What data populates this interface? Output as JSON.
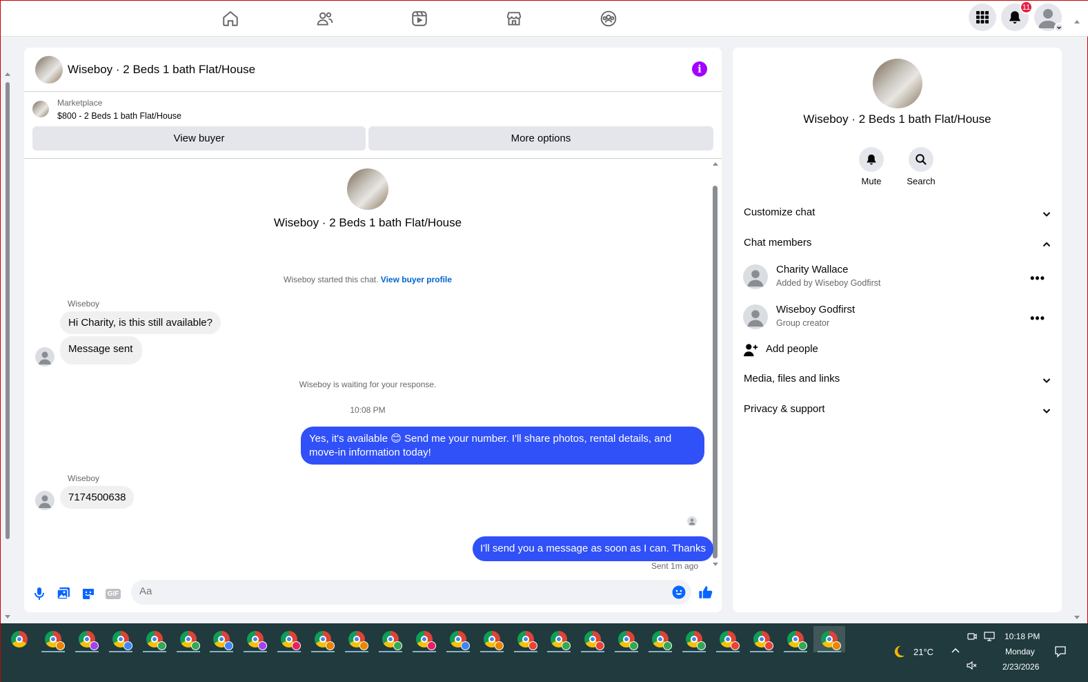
{
  "topnav": {
    "icons": [
      "home-icon",
      "friends-icon",
      "watch-icon",
      "marketplace-icon",
      "groups-icon"
    ],
    "notification_count": "11"
  },
  "chat": {
    "title": "Wiseboy · 2 Beds 1 bath Flat/House",
    "marketplace_label": "Marketplace",
    "listing": "$800 - 2 Beds 1 bath Flat/House",
    "view_buyer": "View buyer",
    "more_options": "More options",
    "intro_title": "Wiseboy · 2 Beds 1 bath Flat/House",
    "started_text": "Wiseboy started this chat.",
    "started_link": "View buyer profile",
    "messages": [
      {
        "sender": "Wiseboy",
        "text": "Hi Charity, is this still available?"
      },
      {
        "text": "Message sent"
      },
      {
        "system": "Wiseboy is waiting for your response."
      },
      {
        "time": "10:08 PM"
      },
      {
        "text": "Yes, it's available 😊 Send me your number. I'll share photos, rental details, and move-in information today!"
      },
      {
        "sender": "Wiseboy",
        "text": "7174500638"
      },
      {
        "text": "I'll send you a message as soon as I can. Thanks"
      }
    ],
    "sent_status": "Sent 1m ago",
    "composer_placeholder": "Aa",
    "gif_label": "GIF"
  },
  "info": {
    "title": "Wiseboy · 2 Beds 1 bath Flat/House",
    "mute": "Mute",
    "search": "Search",
    "customize": "Customize chat",
    "members_header": "Chat members",
    "members": [
      {
        "name": "Charity Wallace",
        "sub": "Added by Wiseboy Godfirst"
      },
      {
        "name": "Wiseboy Godfirst",
        "sub": "Group creator"
      }
    ],
    "add_people": "Add people",
    "media": "Media, files and links",
    "privacy": "Privacy & support"
  },
  "taskbar": {
    "temperature": "21°C",
    "time": "10:18 PM",
    "day": "Monday",
    "date": "2/23/2026"
  },
  "colors": {
    "accent": "#0866ff",
    "outgoing_bubble": "#3050f8",
    "info_purple": "#a100ff",
    "badge_red": "#e41e3f"
  }
}
